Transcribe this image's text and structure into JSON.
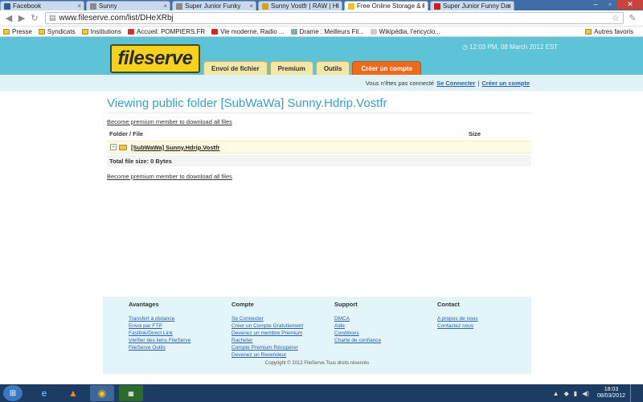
{
  "browser": {
    "tabs": [
      {
        "label": "Facebook",
        "color": "#3b5998",
        "active": false
      },
      {
        "label": "Sunny",
        "color": "#8a8a8a",
        "active": false
      },
      {
        "label": "Super Junior Funky",
        "color": "#8a8a8a",
        "active": false
      },
      {
        "label": "Sunny Vostfr | RAW | HDRip",
        "color": "#d9a01e",
        "active": false
      },
      {
        "label": "Free Online Storage & File U",
        "color": "#f5c21e",
        "active": true
      },
      {
        "label": "Super Junior Funny Dance I",
        "color": "#cc1f1f",
        "active": false
      }
    ],
    "url": "www.fileserve.com/list/DHeXRbj",
    "bookmarks": [
      {
        "label": "Presse",
        "type": "folder"
      },
      {
        "label": "Syndicats",
        "type": "folder"
      },
      {
        "label": "Institutions",
        "type": "folder"
      },
      {
        "label": "Accueil: POMPIERS.FR",
        "type": "site"
      },
      {
        "label": "Vie moderne, Radio ...",
        "type": "site"
      },
      {
        "label": "Drame : Meilleurs Fil...",
        "type": "site"
      },
      {
        "label": "Wikipédia, l'encyclo...",
        "type": "site"
      }
    ],
    "other_bookmarks": "Autres favoris"
  },
  "site": {
    "logo": "fileserve",
    "timestamp": "12:03 PM, 08 March 2012 EST",
    "nav": {
      "upload": "Envoi de fichier",
      "premium": "Premium",
      "tools": "Outils",
      "signup": "Créer un compte"
    },
    "login_bar": {
      "prefix": "Vous n'êtes pas connecté",
      "login": "Se Connecter",
      "separator": "|",
      "create": "Créer un compte"
    }
  },
  "main": {
    "title": "Viewing public folder [SubWaWa] Sunny.Hdrip.Vostfr",
    "premium_link": "Become premium member to download all files",
    "table": {
      "col_name": "Folder / File",
      "col_size": "Size",
      "rows": [
        {
          "name": "[SubWaWa] Sunny.Hdrip.Vostfr"
        }
      ],
      "total": "Total file size: 0 Bytes"
    },
    "premium_link_bottom": "Become premium member to download all files"
  },
  "footer": {
    "columns": [
      {
        "heading": "Avantages",
        "links": [
          "Transfert à distance",
          "Envoi par FTP",
          "Fastlink/Direct Link",
          "Vérifier des liens FileServe",
          "FileServe Outils"
        ]
      },
      {
        "heading": "Compte",
        "links": [
          "Se Connecter",
          "Créer un Compte Gratuitement",
          "Devenez un membre Premium",
          "Racheter",
          "Compte Premium Récupérer",
          "Devenez un Revendeur"
        ]
      },
      {
        "heading": "Support",
        "links": [
          "DMCA",
          "Aide",
          "Conditions",
          "Charte de confiance"
        ]
      },
      {
        "heading": "Contact",
        "links": [
          "A propos de nous",
          "Contactez nous"
        ]
      }
    ],
    "copyright": "Copyright © 2012 FileServe.Tous droits réservés"
  },
  "taskbar": {
    "time": "18:03",
    "date": "08/03/2012"
  }
}
